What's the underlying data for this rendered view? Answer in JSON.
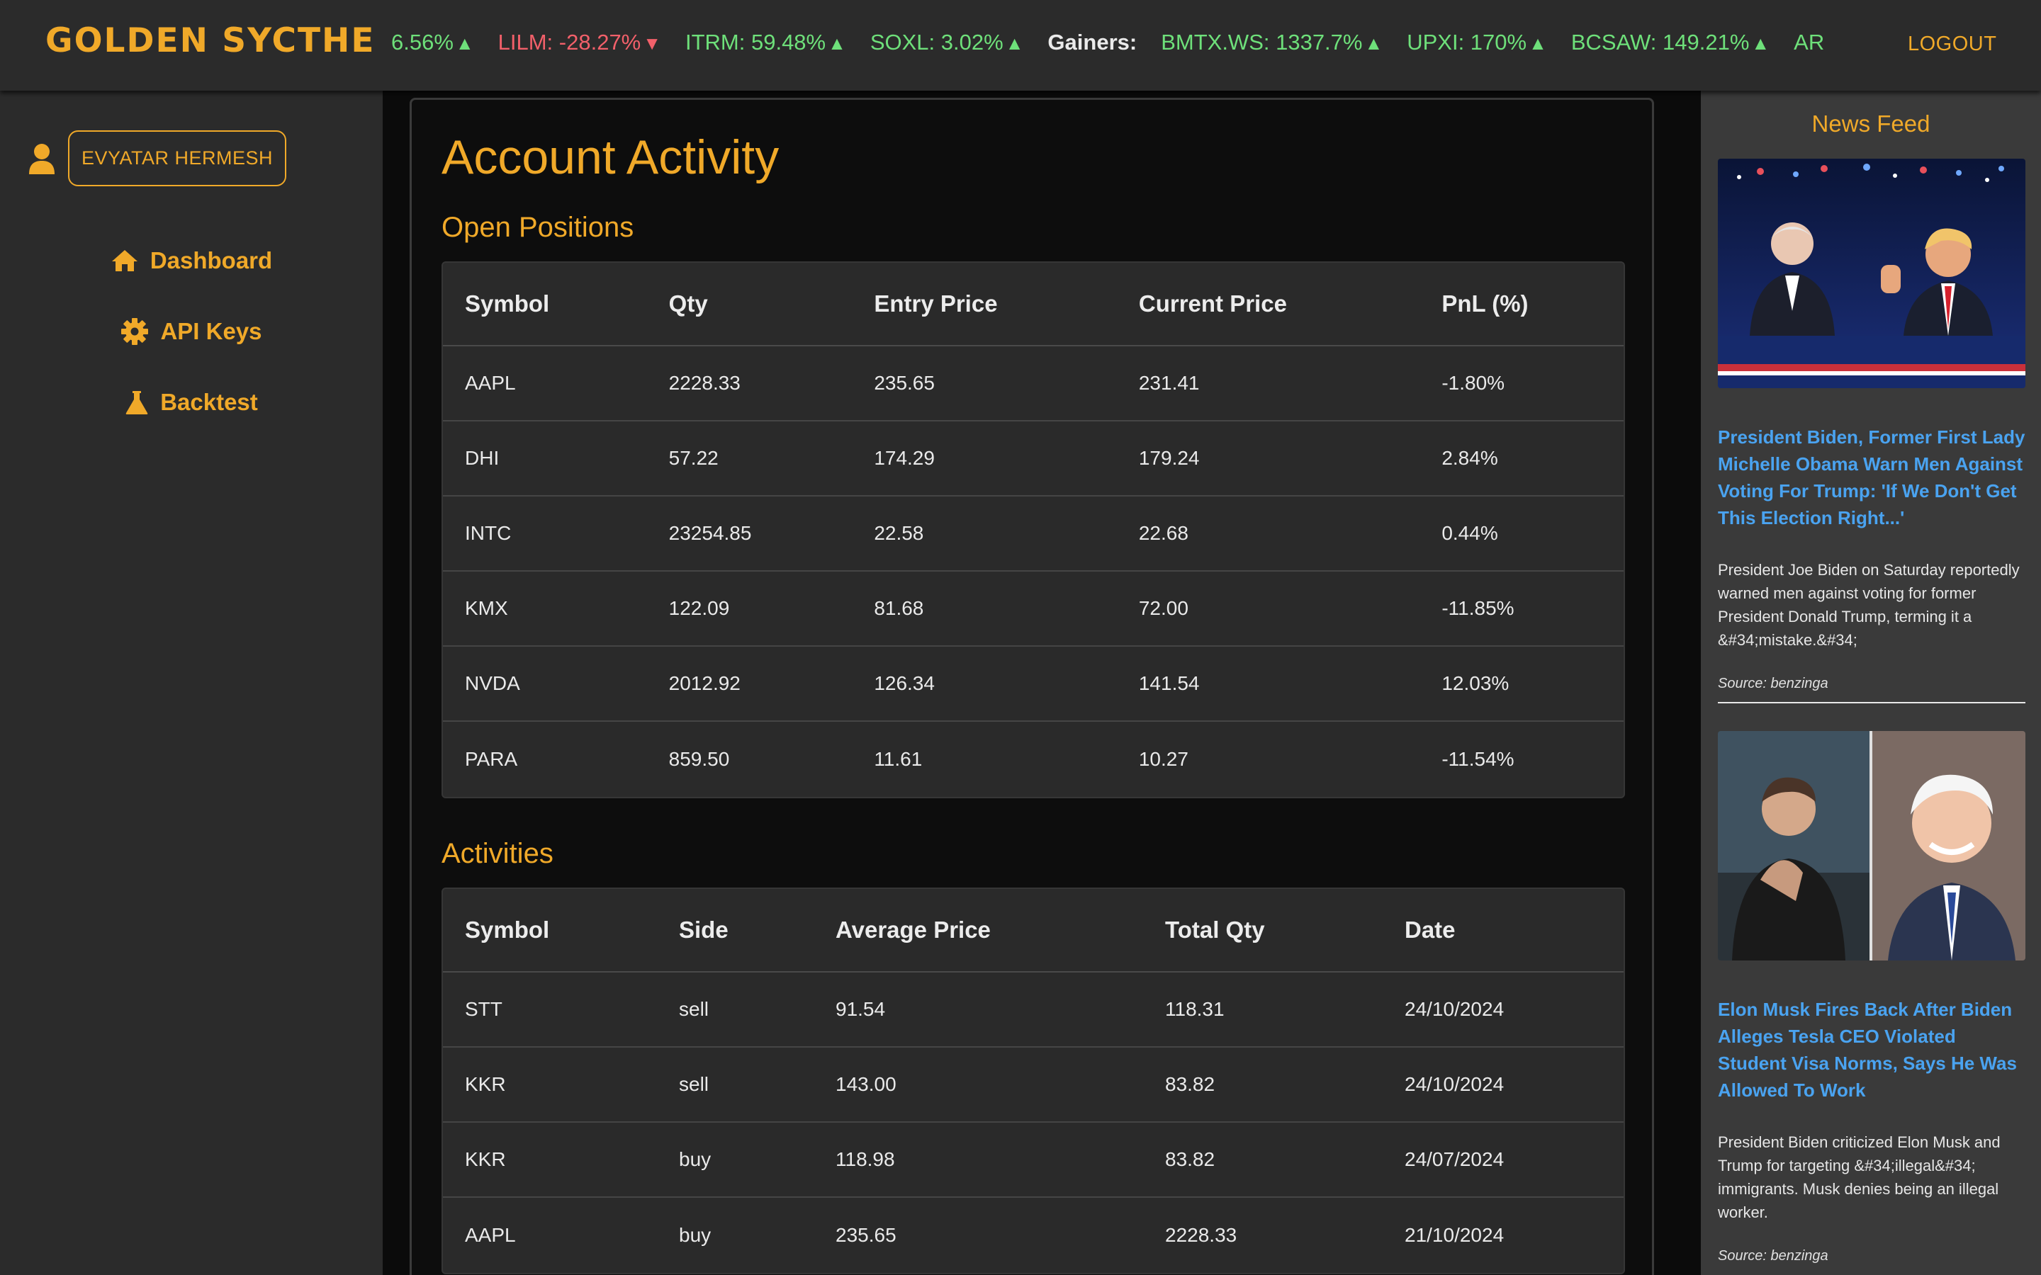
{
  "brand": "GOLDEN SYCTHE",
  "ticker": [
    {
      "text": "6.56%",
      "dir": "up"
    },
    {
      "text": "LILM: -28.27%",
      "dir": "down"
    },
    {
      "text": "ITRM: 59.48%",
      "dir": "up"
    },
    {
      "text": "SOXL: 3.02%",
      "dir": "up"
    }
  ],
  "gainers_label": "Gainers:",
  "gainers": [
    {
      "text": "BMTX.WS: 1337.7%",
      "dir": "up"
    },
    {
      "text": "UPXI: 170%",
      "dir": "up"
    },
    {
      "text": "BCSAW: 149.21%",
      "dir": "up"
    },
    {
      "text": "AR",
      "dir": "up"
    }
  ],
  "logout": "LOGOUT",
  "user": {
    "name": "EVYATAR HERMESH"
  },
  "nav": {
    "dashboard": "Dashboard",
    "api_keys": "API Keys",
    "backtest": "Backtest"
  },
  "page_title": "Account Activity",
  "open_positions": {
    "title": "Open Positions",
    "headers": [
      "Symbol",
      "Qty",
      "Entry Price",
      "Current Price",
      "PnL (%)"
    ],
    "rows": [
      [
        "AAPL",
        "2228.33",
        "235.65",
        "231.41",
        "-1.80%"
      ],
      [
        "DHI",
        "57.22",
        "174.29",
        "179.24",
        "2.84%"
      ],
      [
        "INTC",
        "23254.85",
        "22.58",
        "22.68",
        "0.44%"
      ],
      [
        "KMX",
        "122.09",
        "81.68",
        "72.00",
        "-11.85%"
      ],
      [
        "NVDA",
        "2012.92",
        "126.34",
        "141.54",
        "12.03%"
      ],
      [
        "PARA",
        "859.50",
        "11.61",
        "10.27",
        "-11.54%"
      ]
    ]
  },
  "activities": {
    "title": "Activities",
    "headers": [
      "Symbol",
      "Side",
      "Average Price",
      "Total Qty",
      "Date"
    ],
    "rows": [
      [
        "STT",
        "sell",
        "91.54",
        "118.31",
        "24/10/2024"
      ],
      [
        "KKR",
        "sell",
        "143.00",
        "83.82",
        "24/10/2024"
      ],
      [
        "KKR",
        "buy",
        "118.98",
        "83.82",
        "24/07/2024"
      ],
      [
        "AAPL",
        "buy",
        "235.65",
        "2228.33",
        "21/10/2024"
      ]
    ]
  },
  "news": {
    "title": "News Feed",
    "items": [
      {
        "headline": "President Biden, Former First Lady Michelle Obama Warn Men Against Voting For Trump: 'If We Don't Get This Election Right...'",
        "summary": "President Joe Biden on Saturday reportedly warned men against voting for former President Donald Trump, terming it a &#34;mistake.&#34;",
        "source": "Source: benzinga"
      },
      {
        "headline": "Elon Musk Fires Back After Biden Alleges Tesla CEO Violated Student Visa Norms, Says He Was Allowed To Work",
        "summary": "President Biden criticized Elon Musk and Trump for targeting &#34;illegal&#34; immigrants. Musk denies being an illegal worker.",
        "source": "Source: benzinga"
      }
    ]
  },
  "colors": {
    "accent": "#f0a929",
    "up": "#6ee07a",
    "down": "#f2606a",
    "link": "#4aa3f0"
  }
}
